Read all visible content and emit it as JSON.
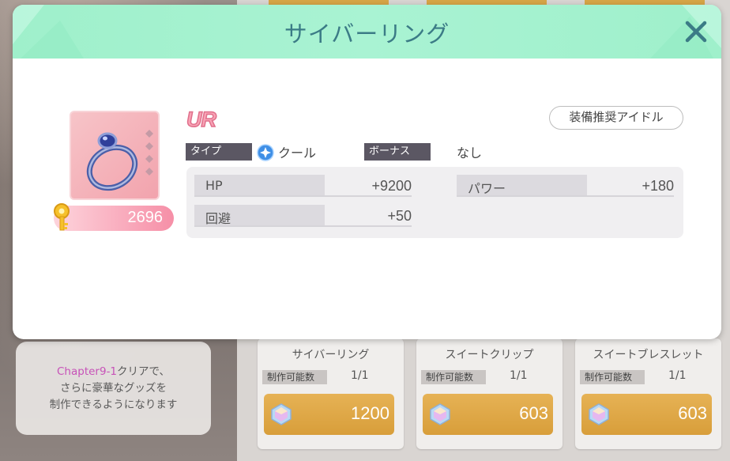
{
  "modal": {
    "title": "サイバーリング",
    "rarity": "UR",
    "quantity": "2696",
    "recommend_button": "装備推奨アイドル",
    "type_label": "タイプ",
    "type_value": "クール",
    "bonus_label": "ボーナス",
    "bonus_value": "なし",
    "stats": [
      {
        "label": "HP",
        "value": "+9200"
      },
      {
        "label": "パワー",
        "value": "+180"
      },
      {
        "label": "回避",
        "value": "+50"
      }
    ]
  },
  "hint": {
    "line1_highlight": "Chapter9-1",
    "line1_rest": "クリアで、",
    "line2": "さらに豪華なグッズを",
    "line3": "制作できるようになります"
  },
  "items": [
    {
      "name": "サイバーリング",
      "count_label": "制作可能数",
      "count": "1/1",
      "cost": "1200"
    },
    {
      "name": "スイートクリップ",
      "count_label": "制作可能数",
      "count": "1/1",
      "cost": "603"
    },
    {
      "name": "スイートブレスレット",
      "count_label": "制作可能数",
      "count": "1/1",
      "cost": "603"
    }
  ],
  "colors": {
    "header": "#a9f3d3",
    "title": "#3b7b86",
    "tag": "#5b5763",
    "cost_button": "#e6b255",
    "pill": "#f68fa7"
  }
}
